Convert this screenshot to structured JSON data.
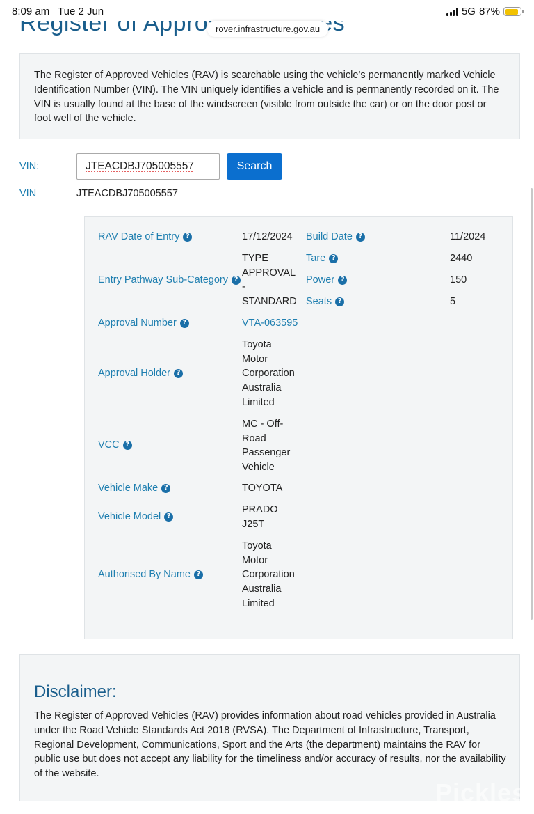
{
  "status_bar": {
    "time": "8:09 am",
    "date": "Tue 2 Jun",
    "network": "5G",
    "battery": "87%",
    "battery_level": 0.87
  },
  "page": {
    "heading": "Register of Approved Vehicles",
    "url": "rover.infrastructure.gov.au",
    "intro": "The Register of Approved Vehicles (RAV) is searchable using the vehicle’s permanently marked Vehicle Identification Number (VIN). The VIN uniquely identifies a vehicle and is permanently recorded on it. The VIN is usually found at the base of the windscreen (visible from outside the car) or on the door post or foot well of the vehicle."
  },
  "search": {
    "label": "VIN:",
    "value": "JTEACDBJ705005557",
    "button": "Search"
  },
  "result": {
    "vin_label": "VIN",
    "vin_value": "JTEACDBJ705005557"
  },
  "details": {
    "rav_date_label": "RAV Date of Entry",
    "rav_date_value": "17/12/2024",
    "pathway_label": "Entry Pathway Sub-Category",
    "pathway_line1": "TYPE",
    "pathway_line2": "APPROVAL",
    "pathway_line3": "-",
    "pathway_line4": "STANDARD",
    "approval_number_label": "Approval Number",
    "approval_number_value": "VTA-063595",
    "approval_holder_label": "Approval Holder",
    "approval_holder_value": [
      "Toyota",
      "Motor",
      "Corporation",
      "Australia",
      "Limited"
    ],
    "vcc_label": "VCC",
    "vcc_value": [
      "MC - Off-",
      "Road",
      "Passenger",
      "Vehicle"
    ],
    "make_label": "Vehicle Make",
    "make_value": "TOYOTA",
    "model_label": "Vehicle Model",
    "model_value": [
      "PRADO",
      "J25T"
    ],
    "authorised_label": "Authorised By Name",
    "authorised_value": [
      "Toyota",
      "Motor",
      "Corporation",
      "Australia",
      "Limited"
    ],
    "build_date_label": "Build Date",
    "build_date_value": "11/2024",
    "tare_label": "Tare",
    "tare_value": "2440",
    "power_label": "Power",
    "power_value": "150",
    "seats_label": "Seats",
    "seats_value": "5"
  },
  "disclaimer": {
    "title": "Disclaimer:",
    "text": "The Register of Approved Vehicles (RAV) provides information about road vehicles provided in Australia under the Road Vehicle Standards Act 2018 (RVSA). The Department of Infrastructure, Transport, Regional Development, Communications, Sport and the Arts (the department) maintains the RAV for public use but does not accept any liability for the timeliness and/or accuracy of results, nor the availability of the website."
  },
  "watermark": "Pickles",
  "icons": {
    "help": "question-circle-icon",
    "signal": "cellular-signal-icon",
    "battery": "battery-icon"
  },
  "colors": {
    "link": "#1f7fb0",
    "button": "#0b6fcf",
    "battery": "#f2c200"
  }
}
